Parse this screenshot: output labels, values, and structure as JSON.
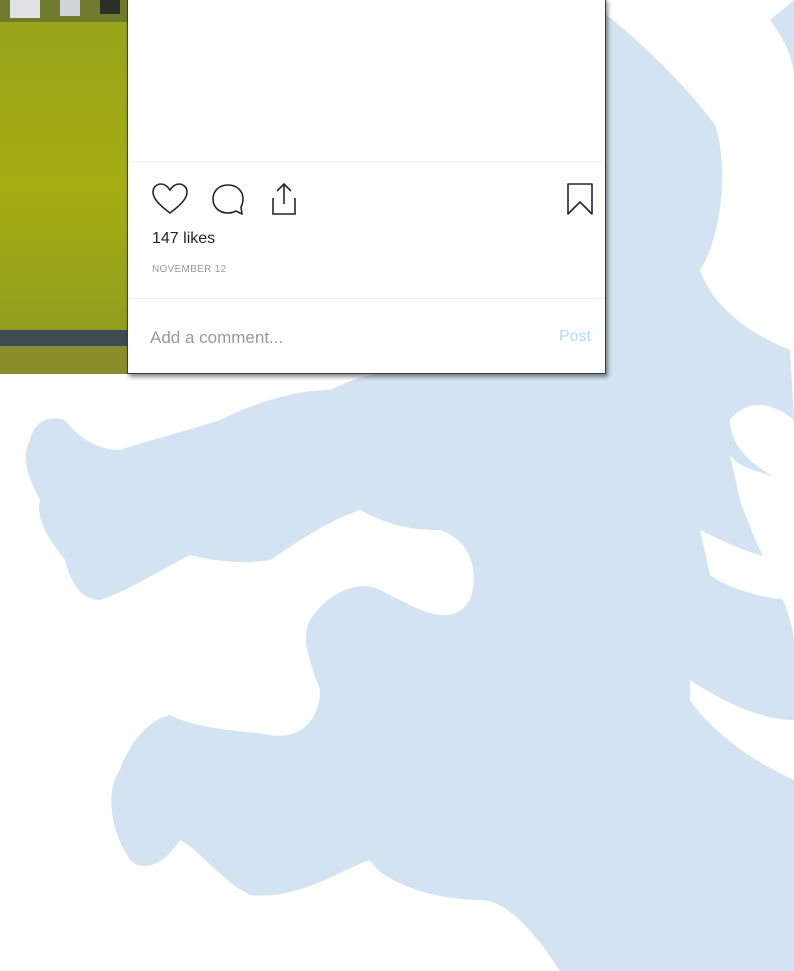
{
  "post": {
    "likes": "147 likes",
    "date": "NOVEMBER 12"
  },
  "comment": {
    "placeholder": "Add a comment...",
    "post_label": "Post"
  },
  "icons": {
    "like": "heart-icon",
    "comment": "comment-bubble-icon",
    "share": "share-icon",
    "save": "bookmark-icon"
  },
  "colors": {
    "background_crest": "#d3e3f1",
    "post_button": "#b3dbff",
    "text_primary": "#262626",
    "text_secondary": "#999999"
  }
}
